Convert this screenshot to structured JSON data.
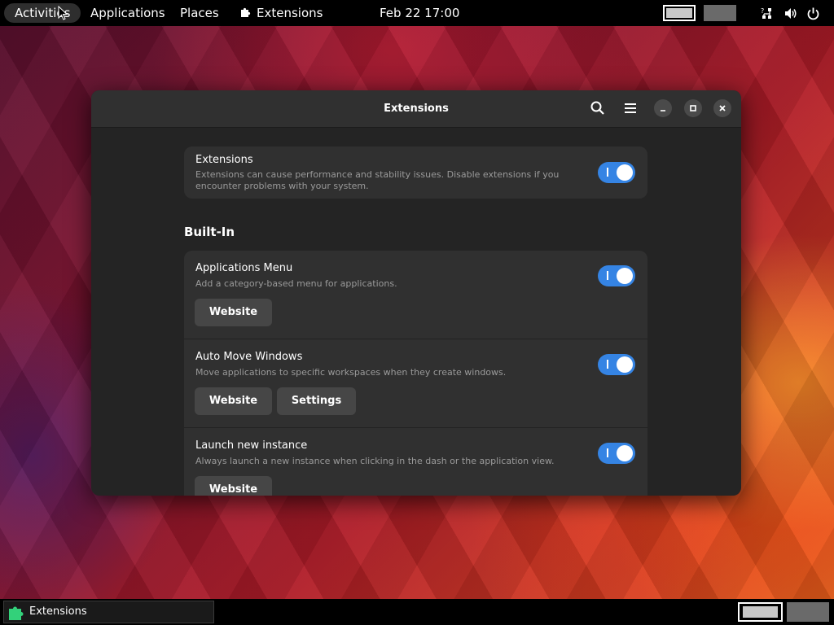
{
  "topbar": {
    "activities": "Activities",
    "applications": "Applications",
    "places": "Places",
    "extensions_app": "Extensions",
    "clock": "Feb 22  17:00",
    "tray_icons": [
      "network-icon",
      "volume-icon",
      "power-icon"
    ]
  },
  "window": {
    "title": "Extensions",
    "header_icons": [
      "search-icon",
      "menu-icon",
      "minimize-icon",
      "maximize-icon",
      "close-icon"
    ],
    "master": {
      "title": "Extensions",
      "description": "Extensions can cause performance and stability issues. Disable extensions if you encounter problems with your system.",
      "enabled": true
    },
    "section_title": "Built-In",
    "extensions": [
      {
        "name": "Applications Menu",
        "description": "Add a category-based menu for applications.",
        "enabled": true,
        "website_label": "Website"
      },
      {
        "name": "Auto Move Windows",
        "description": "Move applications to specific workspaces when they create windows.",
        "enabled": true,
        "website_label": "Website",
        "settings_label": "Settings"
      },
      {
        "name": "Launch new instance",
        "description": "Always launch a new instance when clicking in the dash or the application view.",
        "enabled": true,
        "website_label": "Website"
      }
    ]
  },
  "taskbar": {
    "task_label": "Extensions"
  },
  "colors": {
    "accent": "#3584e4",
    "window_bg": "#242424",
    "card_bg": "#303030"
  }
}
